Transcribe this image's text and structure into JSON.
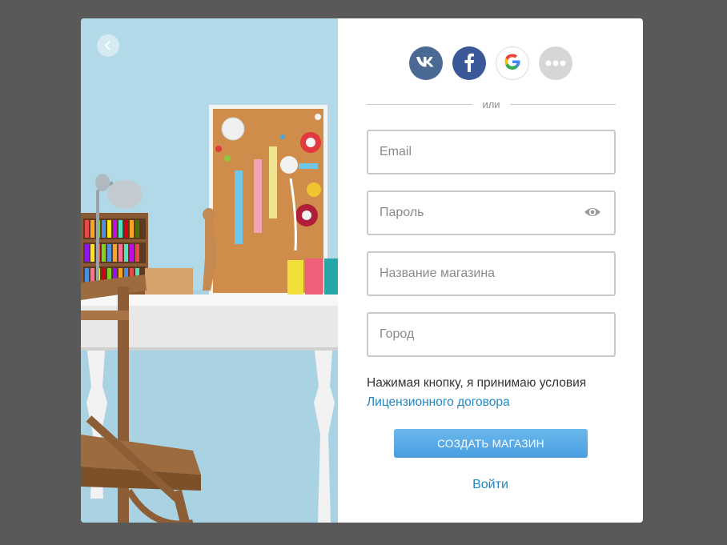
{
  "social": {
    "vk_label": "VK",
    "fb_label": "f",
    "google_label": "G",
    "icons": [
      "vk-icon",
      "facebook-icon",
      "google-icon",
      "more-icon"
    ],
    "colors": {
      "vk": "#4a6a93",
      "facebook": "#3b5998",
      "more": "#d6d6d6"
    }
  },
  "divider_text": "или",
  "fields": {
    "email_placeholder": "Email",
    "password_placeholder": "Пароль",
    "store_placeholder": "Название магазина",
    "city_placeholder": "Город"
  },
  "terms": {
    "text": "Нажимая кнопку, я принимаю условия",
    "link": "Лицензионного договора"
  },
  "create_button": "СОЗДАТЬ МАГАЗИН",
  "login_link": "Войти",
  "colors": {
    "accent": "#1e88c7",
    "button": "#4a9ee0",
    "backdrop": "#595959"
  }
}
